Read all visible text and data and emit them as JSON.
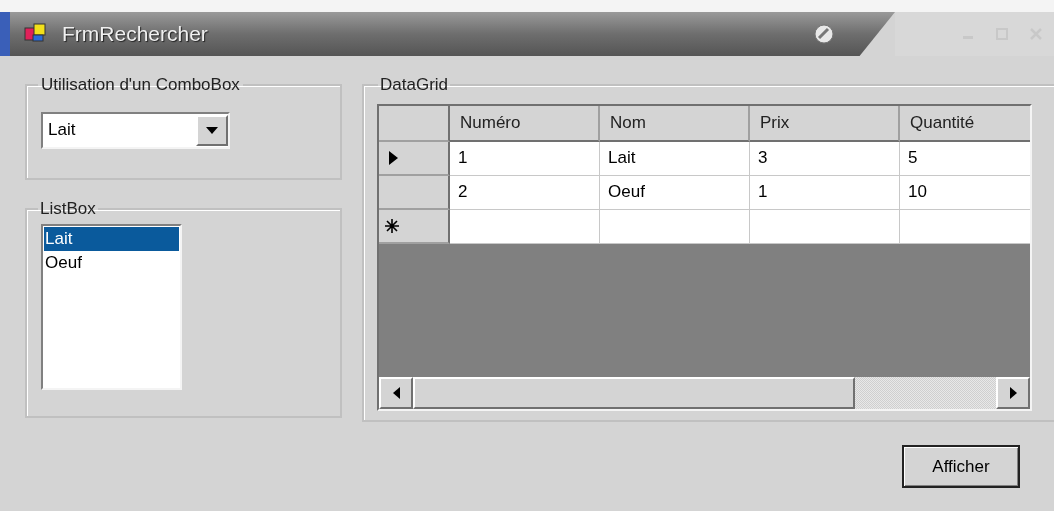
{
  "window": {
    "title": "FrmRechercher"
  },
  "combo_group": {
    "title": "Utilisation d'un ComboBox",
    "combo": {
      "value": "Lait"
    }
  },
  "list_group": {
    "title": "ListBox",
    "items": [
      {
        "label": "Lait",
        "selected": true
      },
      {
        "label": "Oeuf",
        "selected": false
      }
    ]
  },
  "grid_group": {
    "title": "DataGrid",
    "columns": [
      "Numéro",
      "Nom",
      "Prix",
      "Quantité"
    ],
    "rows": [
      {
        "current": true,
        "cells": [
          "1",
          "Lait",
          "3",
          "5"
        ]
      },
      {
        "current": false,
        "cells": [
          "2",
          "Oeuf",
          "1",
          "10"
        ]
      }
    ],
    "new_row": true
  },
  "buttons": [
    "Afficher"
  ]
}
